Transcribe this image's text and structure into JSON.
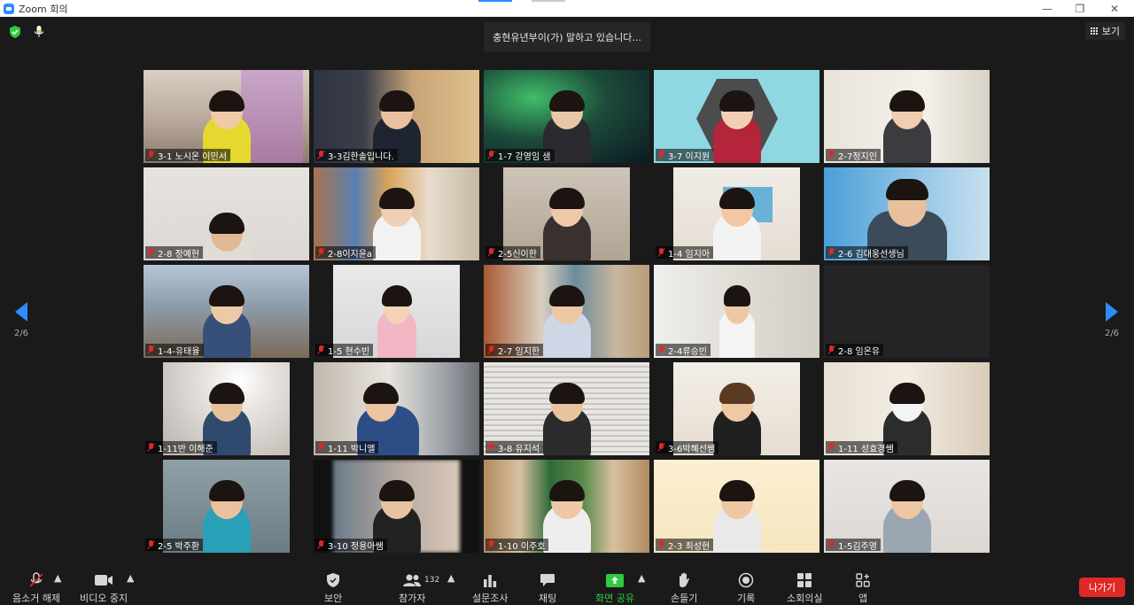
{
  "window": {
    "title": "Zoom 회의"
  },
  "top": {
    "speaking": "충현유년부이(가) 말하고 있습니다...",
    "view_label": "보기"
  },
  "pager": {
    "left": "2/6",
    "right": "2/6"
  },
  "tiles": [
    {
      "label": "3-1 노시온 이민서"
    },
    {
      "label": "3-3김한솔입니다."
    },
    {
      "label": "1-7 강영임 샘"
    },
    {
      "label": "3-7 이지원"
    },
    {
      "label": "2-7정지인"
    },
    {
      "label": "2-8 정예현"
    },
    {
      "label": "2-8이지윤a"
    },
    {
      "label": "2-5신이한"
    },
    {
      "label": "1-4 임지아"
    },
    {
      "label": "2-6 김대웅선생님"
    },
    {
      "label": "1-4-유태율"
    },
    {
      "label": "1-5 현수빈"
    },
    {
      "label": "2-7 임지한"
    },
    {
      "label": "2-4류승빈"
    },
    {
      "label": "2-8 임온유"
    },
    {
      "label": "1-11반 이해준"
    },
    {
      "label": "1-11 박니엘"
    },
    {
      "label": "3-8 유지석"
    },
    {
      "label": "3-6박혜선쌤"
    },
    {
      "label": "1-11 성효경쌤"
    },
    {
      "label": "2-5 박주환"
    },
    {
      "label": "3-10 정용아쌤"
    },
    {
      "label": "1-10 이주호"
    },
    {
      "label": "2-3 최성현"
    },
    {
      "label": "1-5김주영"
    }
  ],
  "toolbar": {
    "audio": "음소거 해제",
    "video": "비디오 중지",
    "security": "보안",
    "participants": "참가자",
    "participants_count": "132",
    "polls": "설문조사",
    "chat": "채팅",
    "share": "화면 공유",
    "reactions": "손들기",
    "record": "기록",
    "breakout": "소회의실",
    "apps": "앱",
    "leave": "나가기"
  },
  "colors": {
    "accent": "#2D8CFF",
    "leave": "#E02828",
    "share": "#2ECC40",
    "muted": "#E02828"
  }
}
